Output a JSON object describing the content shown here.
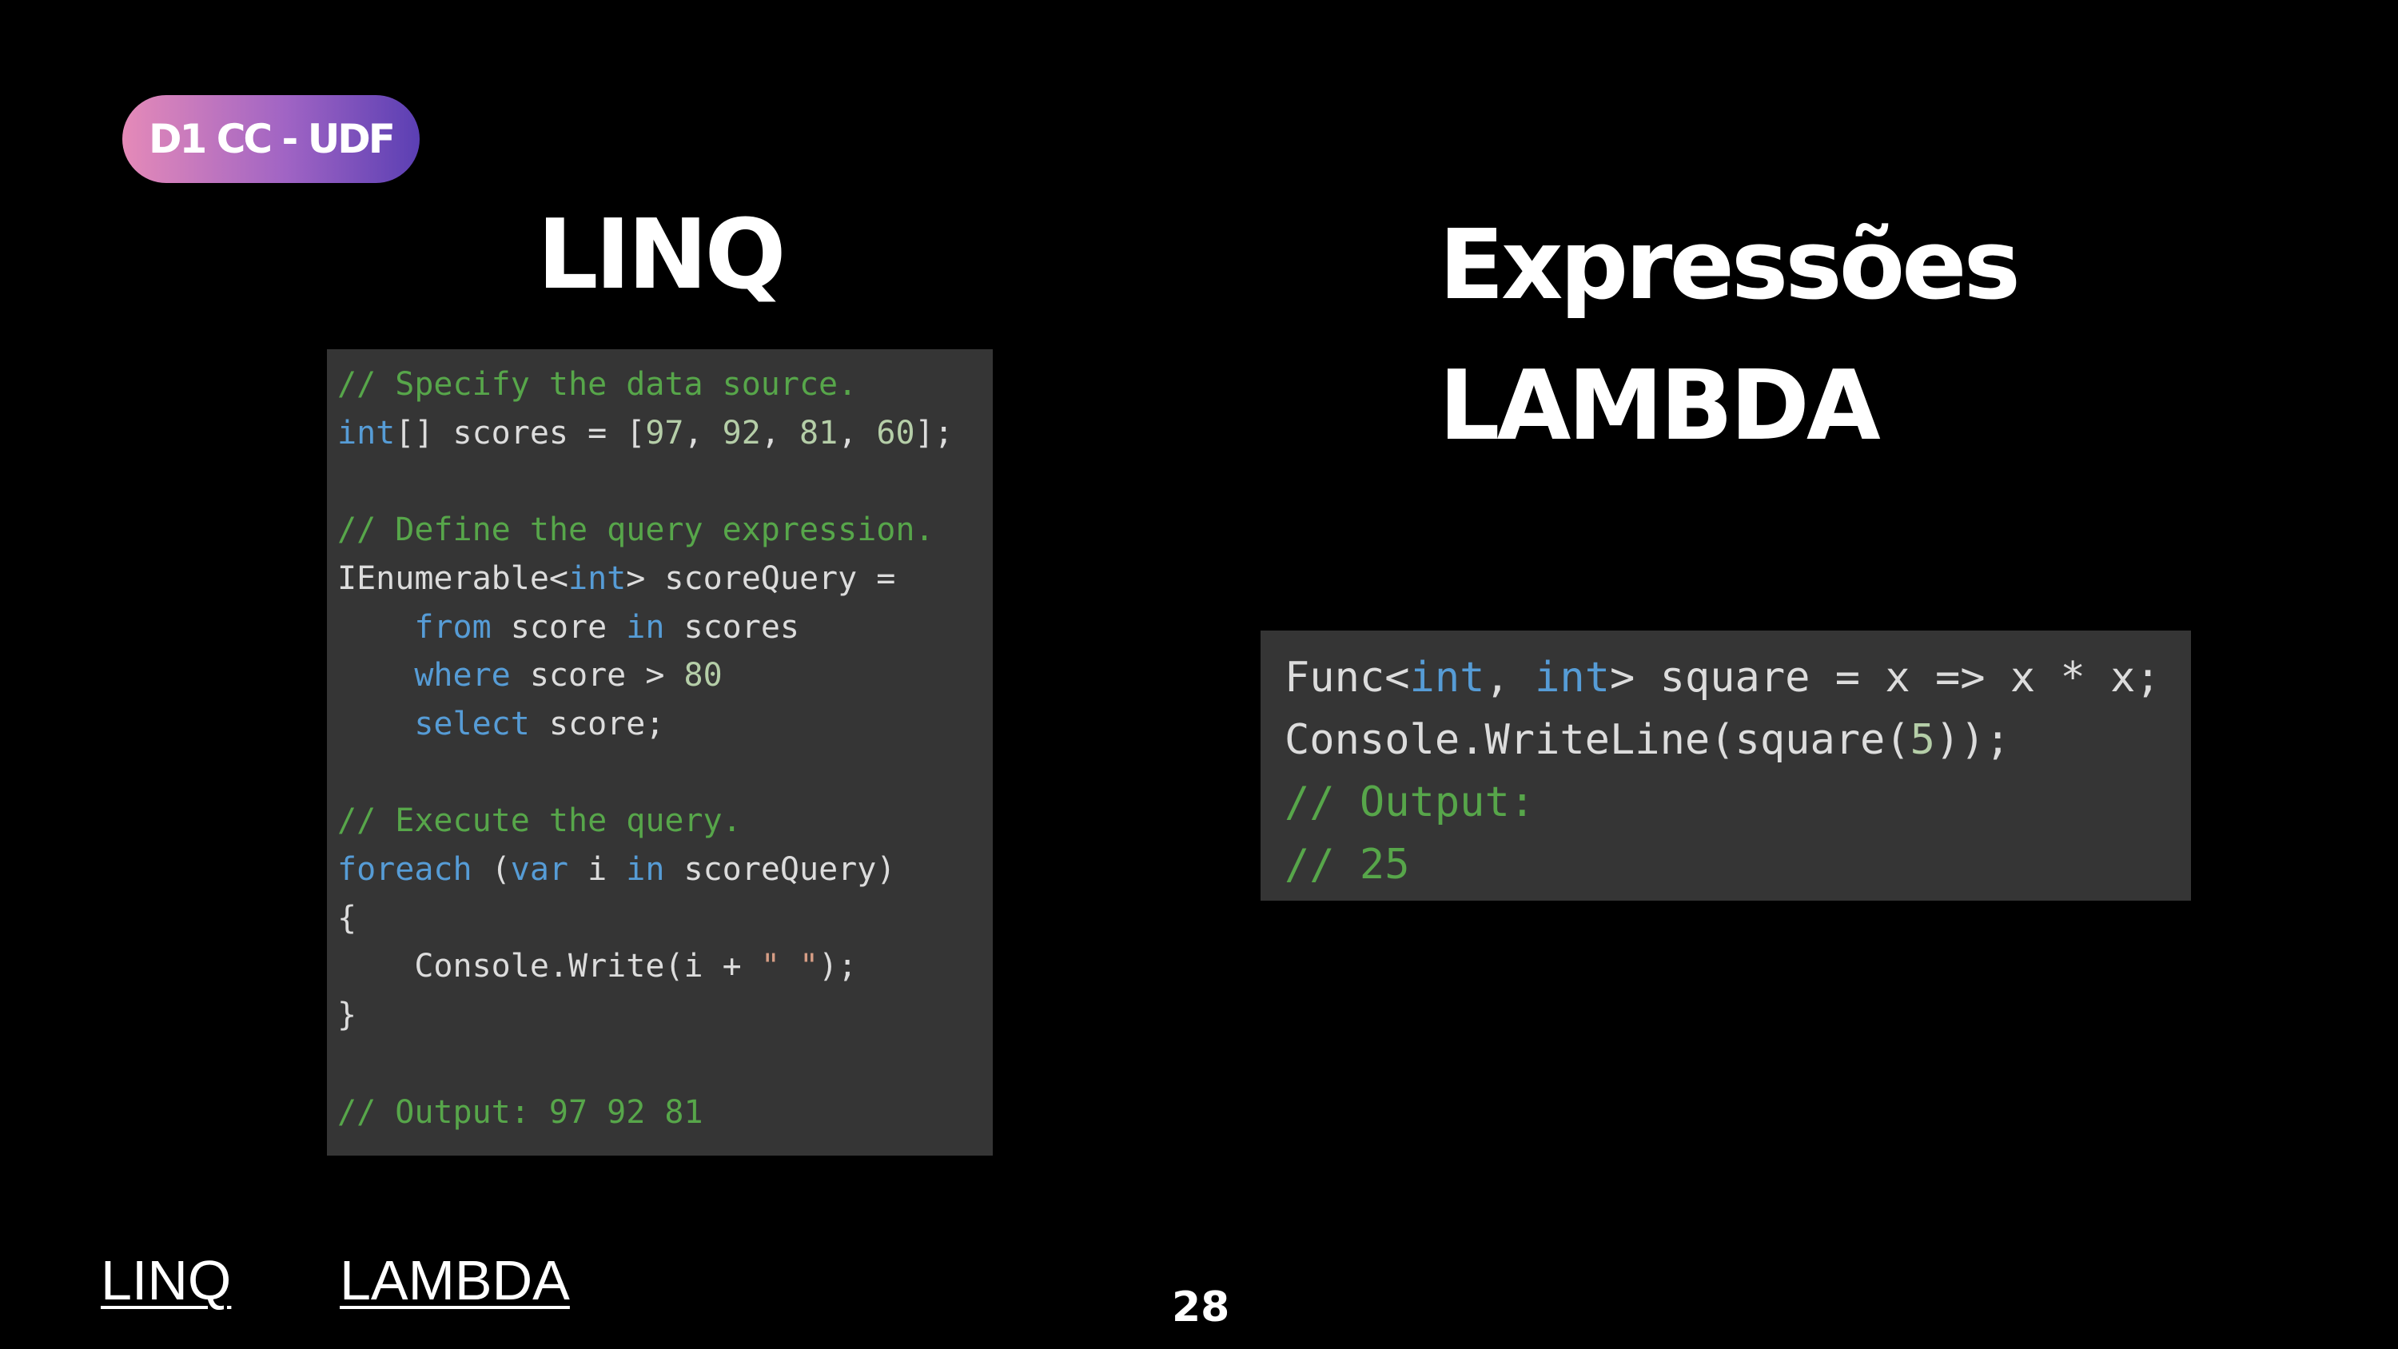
{
  "badge": {
    "label": "D1 CC - UDF"
  },
  "titles": {
    "linq": "LINQ",
    "lambda_line1": "Expressões",
    "lambda_line2": "LAMBDA"
  },
  "linq_code": [
    [
      {
        "t": "// Specify the data source.",
        "c": "cmt"
      }
    ],
    [
      {
        "t": "int",
        "c": "kw"
      },
      {
        "t": "[] scores = [",
        "c": "txt"
      },
      {
        "t": "97",
        "c": "num"
      },
      {
        "t": ", ",
        "c": "txt"
      },
      {
        "t": "92",
        "c": "num"
      },
      {
        "t": ", ",
        "c": "txt"
      },
      {
        "t": "81",
        "c": "num"
      },
      {
        "t": ", ",
        "c": "txt"
      },
      {
        "t": "60",
        "c": "num"
      },
      {
        "t": "];",
        "c": "txt"
      }
    ],
    [
      {
        "t": "",
        "c": "txt"
      }
    ],
    [
      {
        "t": "// Define the query expression.",
        "c": "cmt"
      }
    ],
    [
      {
        "t": "IEnumerable<",
        "c": "txt"
      },
      {
        "t": "int",
        "c": "kw"
      },
      {
        "t": "> scoreQuery =",
        "c": "txt"
      }
    ],
    [
      {
        "t": "    ",
        "c": "txt"
      },
      {
        "t": "from",
        "c": "kw"
      },
      {
        "t": " score ",
        "c": "txt"
      },
      {
        "t": "in",
        "c": "kw"
      },
      {
        "t": " scores",
        "c": "txt"
      }
    ],
    [
      {
        "t": "    ",
        "c": "txt"
      },
      {
        "t": "where",
        "c": "kw"
      },
      {
        "t": " score > ",
        "c": "txt"
      },
      {
        "t": "80",
        "c": "num"
      }
    ],
    [
      {
        "t": "    ",
        "c": "txt"
      },
      {
        "t": "select",
        "c": "kw"
      },
      {
        "t": " score;",
        "c": "txt"
      }
    ],
    [
      {
        "t": "",
        "c": "txt"
      }
    ],
    [
      {
        "t": "// Execute the query.",
        "c": "cmt"
      }
    ],
    [
      {
        "t": "foreach",
        "c": "kw"
      },
      {
        "t": " (",
        "c": "txt"
      },
      {
        "t": "var",
        "c": "kw"
      },
      {
        "t": " i ",
        "c": "txt"
      },
      {
        "t": "in",
        "c": "kw"
      },
      {
        "t": " scoreQuery)",
        "c": "txt"
      }
    ],
    [
      {
        "t": "{",
        "c": "txt"
      }
    ],
    [
      {
        "t": "    Console.Write(i + ",
        "c": "txt"
      },
      {
        "t": "\" \"",
        "c": "str"
      },
      {
        "t": ");",
        "c": "txt"
      }
    ],
    [
      {
        "t": "}",
        "c": "txt"
      }
    ],
    [
      {
        "t": "",
        "c": "txt"
      }
    ],
    [
      {
        "t": "// Output: 97 92 81",
        "c": "cmt"
      }
    ]
  ],
  "lambda_code": [
    [
      {
        "t": "Func<",
        "c": "txt"
      },
      {
        "t": "int",
        "c": "kw"
      },
      {
        "t": ", ",
        "c": "txt"
      },
      {
        "t": "int",
        "c": "kw"
      },
      {
        "t": "> square = x => x * x;",
        "c": "txt"
      }
    ],
    [
      {
        "t": "Console.WriteLine(square(",
        "c": "txt"
      },
      {
        "t": "5",
        "c": "num"
      },
      {
        "t": "));",
        "c": "txt"
      }
    ],
    [
      {
        "t": "// Output:",
        "c": "cmt"
      }
    ],
    [
      {
        "t": "// 25",
        "c": "cmt"
      }
    ]
  ],
  "links": {
    "linq": "LINQ",
    "lambda": "LAMBDA"
  },
  "page_number": "28",
  "colors": {
    "background": "#000000",
    "code_background": "#353535",
    "comment": "#57a64a",
    "keyword": "#569cd6",
    "number": "#b5cea8",
    "string": "#d69d85",
    "text": "#dcdcdc",
    "badge_gradient_start": "#e58ab8",
    "badge_gradient_end": "#5b3fb3"
  }
}
